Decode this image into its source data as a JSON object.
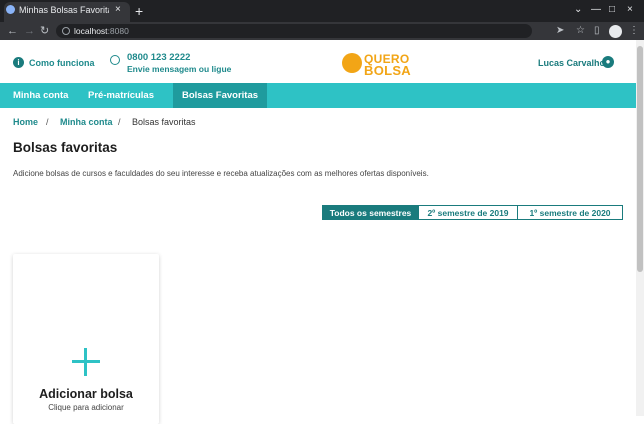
{
  "browser": {
    "tab_title": "Minhas Bolsas Favoritas | ",
    "tab_close": "×",
    "new_tab": "+",
    "url_host": "localhost",
    "url_port": ":8080",
    "window_controls": {
      "dropdown": "⌄",
      "minimize": "—",
      "maximize": "□",
      "close": "×"
    }
  },
  "header": {
    "how_it_works": "Como funciona",
    "phone": "0800 123 2222",
    "phone_sub": "Envie mensagem ou ligue",
    "logo_line1": "QUERO",
    "logo_line2": "BOLSA",
    "user_name": "Lucas Carvalho"
  },
  "nav": {
    "items": [
      {
        "label": "Minha conta"
      },
      {
        "label": "Pré-matrículas"
      },
      {
        "label": "Bolsas Favoritas"
      }
    ]
  },
  "breadcrumb": {
    "home": "Home",
    "account": "Minha conta",
    "current": "Bolsas favoritas",
    "sep": "/"
  },
  "page": {
    "title": "Bolsas favoritas",
    "subtitle": "Adicione bolsas de cursos e faculdades do seu interesse e receba atualizações com as melhores ofertas disponíveis."
  },
  "filters": {
    "options": [
      {
        "label": "Todos os semestres"
      },
      {
        "label": "2º semestre de 2019"
      },
      {
        "label": "1º semestre de 2020"
      }
    ]
  },
  "add_card": {
    "title": "Adicionar bolsa",
    "subtitle": "Clique para adicionar"
  },
  "colors": {
    "accent": "#2ec2c5",
    "accent_dark": "#1a7b7d",
    "logo": "#f2a516"
  }
}
